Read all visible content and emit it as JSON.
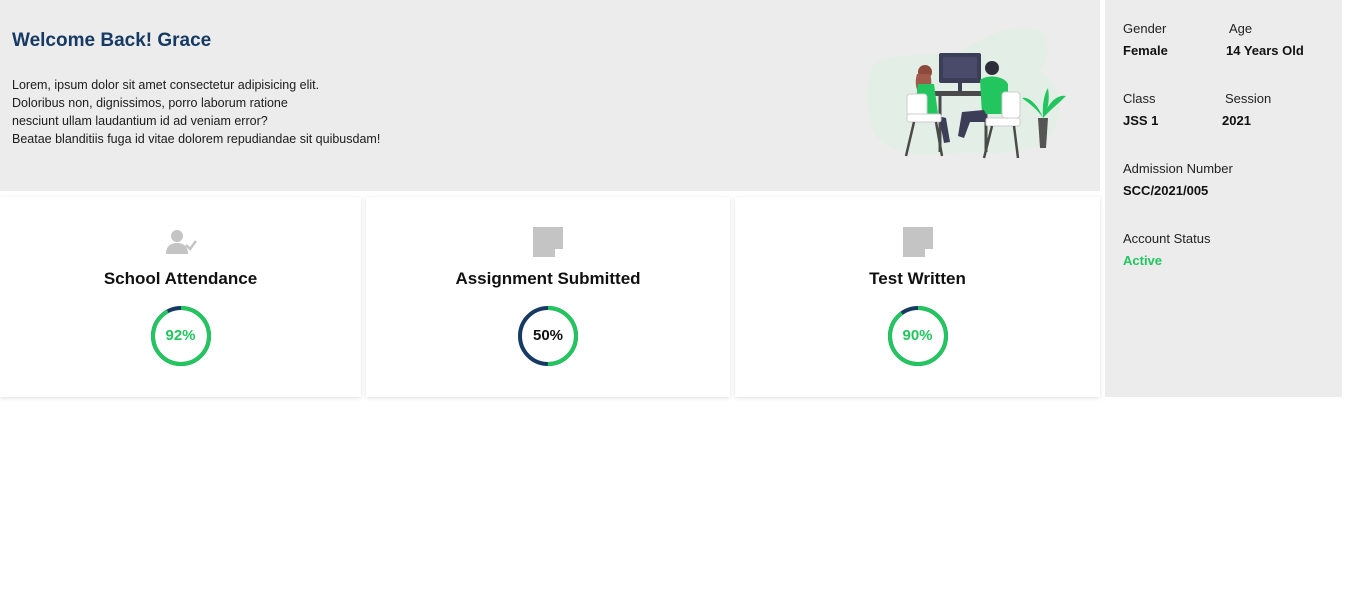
{
  "welcome": {
    "title": "Welcome Back! Grace",
    "lines": [
      "Lorem, ipsum dolor sit amet consectetur adipisicing elit.",
      "Doloribus non, dignissimos, porro laborum ratione",
      "nesciunt ullam laudantium id ad veniam error?",
      "Beatae blanditiis fuga id vitae dolorem repudiandae sit quibusdam!"
    ]
  },
  "profile": {
    "gender_label": "Gender",
    "gender": "Female",
    "age_label": "Age",
    "age": "14 Years Old",
    "class_label": "Class",
    "class": "JSS 1",
    "session_label": "Session",
    "session": "2021",
    "admission_label": "Admission Number",
    "admission": "SCC/2021/005",
    "status_label": "Account Status",
    "status": "Active"
  },
  "cards": [
    {
      "title": "School Attendance",
      "percent": 92,
      "percent_label": "92%",
      "icon": "user-check-icon",
      "text_color": "#22c55e"
    },
    {
      "title": "Assignment Submitted",
      "percent": 50,
      "percent_label": "50%",
      "icon": "sticky-note-icon",
      "text_color": "#111111"
    },
    {
      "title": "Test Written",
      "percent": 90,
      "percent_label": "90%",
      "icon": "sticky-note-icon",
      "text_color": "#22c55e"
    }
  ],
  "colors": {
    "ring_green": "#22c55e",
    "ring_navy": "#163a63",
    "title_navy": "#163a63",
    "panel_bg": "#ececec"
  }
}
